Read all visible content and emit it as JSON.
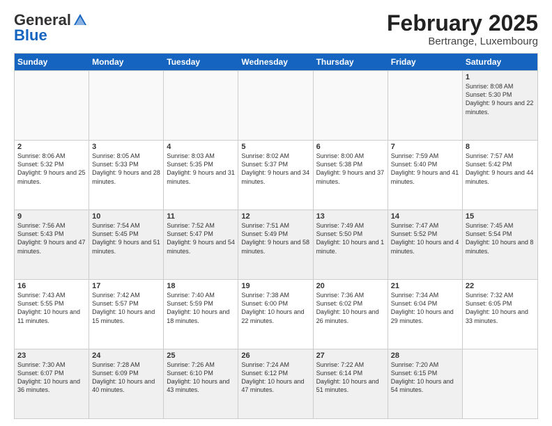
{
  "header": {
    "logo_general": "General",
    "logo_blue": "Blue",
    "month_title": "February 2025",
    "location": "Bertrange, Luxembourg"
  },
  "days_of_week": [
    "Sunday",
    "Monday",
    "Tuesday",
    "Wednesday",
    "Thursday",
    "Friday",
    "Saturday"
  ],
  "weeks": [
    [
      {
        "day": "",
        "info": "",
        "empty": true
      },
      {
        "day": "",
        "info": "",
        "empty": true
      },
      {
        "day": "",
        "info": "",
        "empty": true
      },
      {
        "day": "",
        "info": "",
        "empty": true
      },
      {
        "day": "",
        "info": "",
        "empty": true
      },
      {
        "day": "",
        "info": "",
        "empty": true
      },
      {
        "day": "1",
        "info": "Sunrise: 8:08 AM\nSunset: 5:30 PM\nDaylight: 9 hours and 22 minutes.",
        "empty": false
      }
    ],
    [
      {
        "day": "2",
        "info": "Sunrise: 8:06 AM\nSunset: 5:32 PM\nDaylight: 9 hours and 25 minutes.",
        "empty": false
      },
      {
        "day": "3",
        "info": "Sunrise: 8:05 AM\nSunset: 5:33 PM\nDaylight: 9 hours and 28 minutes.",
        "empty": false
      },
      {
        "day": "4",
        "info": "Sunrise: 8:03 AM\nSunset: 5:35 PM\nDaylight: 9 hours and 31 minutes.",
        "empty": false
      },
      {
        "day": "5",
        "info": "Sunrise: 8:02 AM\nSunset: 5:37 PM\nDaylight: 9 hours and 34 minutes.",
        "empty": false
      },
      {
        "day": "6",
        "info": "Sunrise: 8:00 AM\nSunset: 5:38 PM\nDaylight: 9 hours and 37 minutes.",
        "empty": false
      },
      {
        "day": "7",
        "info": "Sunrise: 7:59 AM\nSunset: 5:40 PM\nDaylight: 9 hours and 41 minutes.",
        "empty": false
      },
      {
        "day": "8",
        "info": "Sunrise: 7:57 AM\nSunset: 5:42 PM\nDaylight: 9 hours and 44 minutes.",
        "empty": false
      }
    ],
    [
      {
        "day": "9",
        "info": "Sunrise: 7:56 AM\nSunset: 5:43 PM\nDaylight: 9 hours and 47 minutes.",
        "empty": false
      },
      {
        "day": "10",
        "info": "Sunrise: 7:54 AM\nSunset: 5:45 PM\nDaylight: 9 hours and 51 minutes.",
        "empty": false
      },
      {
        "day": "11",
        "info": "Sunrise: 7:52 AM\nSunset: 5:47 PM\nDaylight: 9 hours and 54 minutes.",
        "empty": false
      },
      {
        "day": "12",
        "info": "Sunrise: 7:51 AM\nSunset: 5:49 PM\nDaylight: 9 hours and 58 minutes.",
        "empty": false
      },
      {
        "day": "13",
        "info": "Sunrise: 7:49 AM\nSunset: 5:50 PM\nDaylight: 10 hours and 1 minute.",
        "empty": false
      },
      {
        "day": "14",
        "info": "Sunrise: 7:47 AM\nSunset: 5:52 PM\nDaylight: 10 hours and 4 minutes.",
        "empty": false
      },
      {
        "day": "15",
        "info": "Sunrise: 7:45 AM\nSunset: 5:54 PM\nDaylight: 10 hours and 8 minutes.",
        "empty": false
      }
    ],
    [
      {
        "day": "16",
        "info": "Sunrise: 7:43 AM\nSunset: 5:55 PM\nDaylight: 10 hours and 11 minutes.",
        "empty": false
      },
      {
        "day": "17",
        "info": "Sunrise: 7:42 AM\nSunset: 5:57 PM\nDaylight: 10 hours and 15 minutes.",
        "empty": false
      },
      {
        "day": "18",
        "info": "Sunrise: 7:40 AM\nSunset: 5:59 PM\nDaylight: 10 hours and 18 minutes.",
        "empty": false
      },
      {
        "day": "19",
        "info": "Sunrise: 7:38 AM\nSunset: 6:00 PM\nDaylight: 10 hours and 22 minutes.",
        "empty": false
      },
      {
        "day": "20",
        "info": "Sunrise: 7:36 AM\nSunset: 6:02 PM\nDaylight: 10 hours and 26 minutes.",
        "empty": false
      },
      {
        "day": "21",
        "info": "Sunrise: 7:34 AM\nSunset: 6:04 PM\nDaylight: 10 hours and 29 minutes.",
        "empty": false
      },
      {
        "day": "22",
        "info": "Sunrise: 7:32 AM\nSunset: 6:05 PM\nDaylight: 10 hours and 33 minutes.",
        "empty": false
      }
    ],
    [
      {
        "day": "23",
        "info": "Sunrise: 7:30 AM\nSunset: 6:07 PM\nDaylight: 10 hours and 36 minutes.",
        "empty": false
      },
      {
        "day": "24",
        "info": "Sunrise: 7:28 AM\nSunset: 6:09 PM\nDaylight: 10 hours and 40 minutes.",
        "empty": false
      },
      {
        "day": "25",
        "info": "Sunrise: 7:26 AM\nSunset: 6:10 PM\nDaylight: 10 hours and 43 minutes.",
        "empty": false
      },
      {
        "day": "26",
        "info": "Sunrise: 7:24 AM\nSunset: 6:12 PM\nDaylight: 10 hours and 47 minutes.",
        "empty": false
      },
      {
        "day": "27",
        "info": "Sunrise: 7:22 AM\nSunset: 6:14 PM\nDaylight: 10 hours and 51 minutes.",
        "empty": false
      },
      {
        "day": "28",
        "info": "Sunrise: 7:20 AM\nSunset: 6:15 PM\nDaylight: 10 hours and 54 minutes.",
        "empty": false
      },
      {
        "day": "",
        "info": "",
        "empty": true
      }
    ]
  ]
}
